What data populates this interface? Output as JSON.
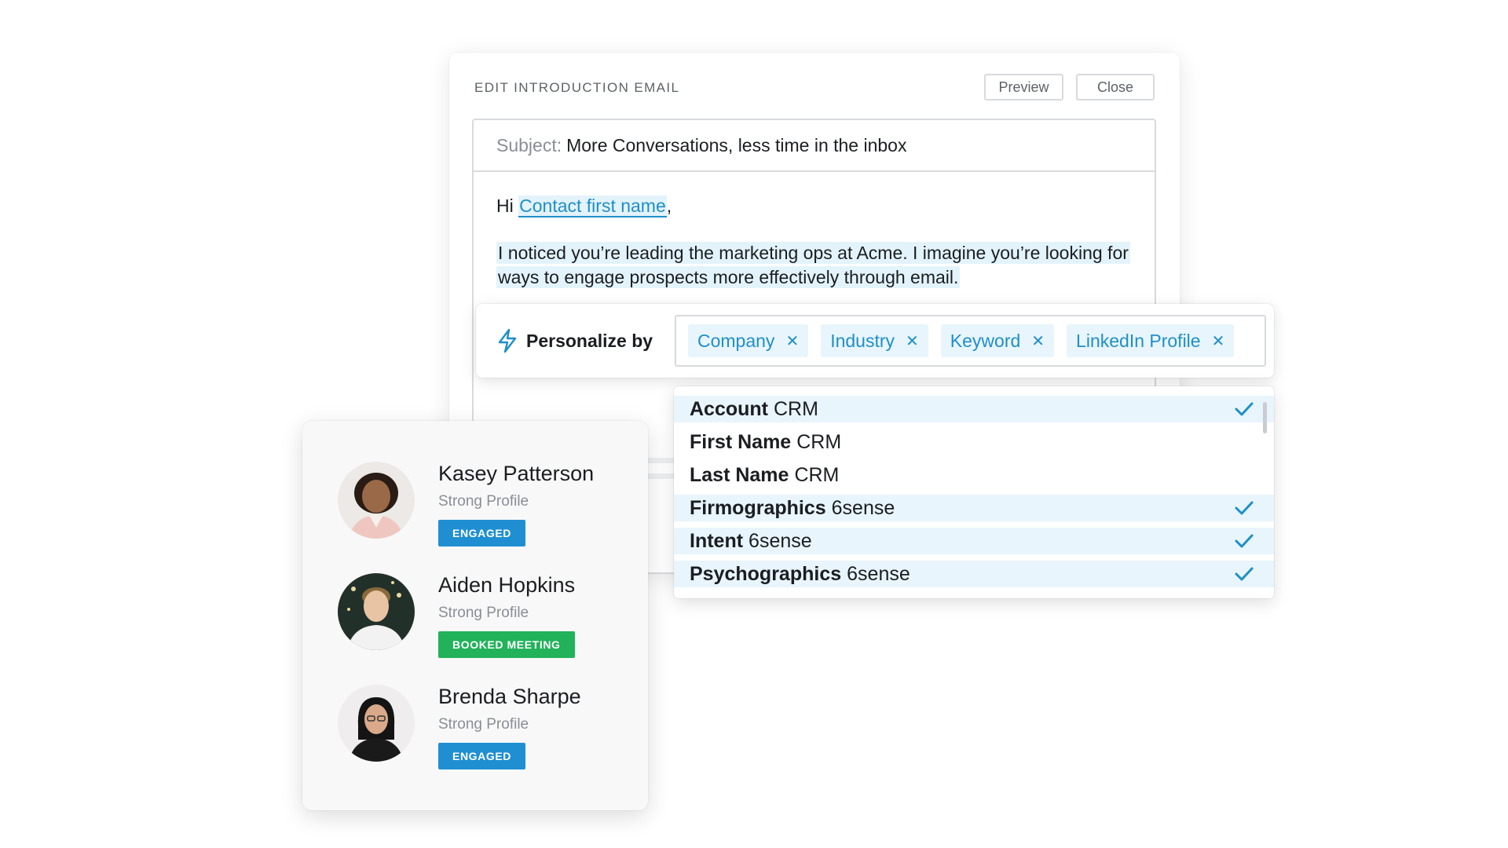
{
  "editor": {
    "title": "EDIT INTRODUCTION EMAIL",
    "preview_label": "Preview",
    "close_label": "Close",
    "subject_label": "Subject:",
    "subject_value": "More Conversations, less time in the inbox",
    "greeting_prefix": "Hi",
    "greeting_token": "Contact first name",
    "greeting_suffix": ",",
    "body_text": "I noticed you’re leading the marketing ops at Acme. I imagine you’re looking for ways to engage prospects more effectively through email."
  },
  "personalize": {
    "label": "Personalize by",
    "icon": "lightning-bolt-icon",
    "tags": [
      {
        "label": "Company"
      },
      {
        "label": "Industry"
      },
      {
        "label": "Keyword"
      },
      {
        "label": "LinkedIn Profile"
      }
    ],
    "remove_glyph": "✕"
  },
  "dropdown": {
    "items": [
      {
        "name": "Account",
        "source": "CRM",
        "selected": true
      },
      {
        "name": "First Name",
        "source": "CRM",
        "selected": false
      },
      {
        "name": "Last Name",
        "source": "CRM",
        "selected": false
      },
      {
        "name": "Firmographics",
        "source": "6sense",
        "selected": true
      },
      {
        "name": "Intent",
        "source": "6sense",
        "selected": true
      },
      {
        "name": "Psychographics",
        "source": "6sense",
        "selected": true
      }
    ]
  },
  "contacts": [
    {
      "name": "Kasey Patterson",
      "profile": "Strong Profile",
      "status": "ENGAGED",
      "status_color": "#1f8fd2"
    },
    {
      "name": "Aiden Hopkins",
      "profile": "Strong Profile",
      "status": "BOOKED MEETING",
      "status_color": "#21b25a"
    },
    {
      "name": "Brenda Sharpe",
      "profile": "Strong Profile",
      "status": "ENGAGED",
      "status_color": "#1f8fd2"
    }
  ],
  "colors": {
    "accent": "#1f8fc8",
    "highlight": "#e3f3fb",
    "engaged": "#1f8fd2",
    "booked": "#21b25a"
  }
}
